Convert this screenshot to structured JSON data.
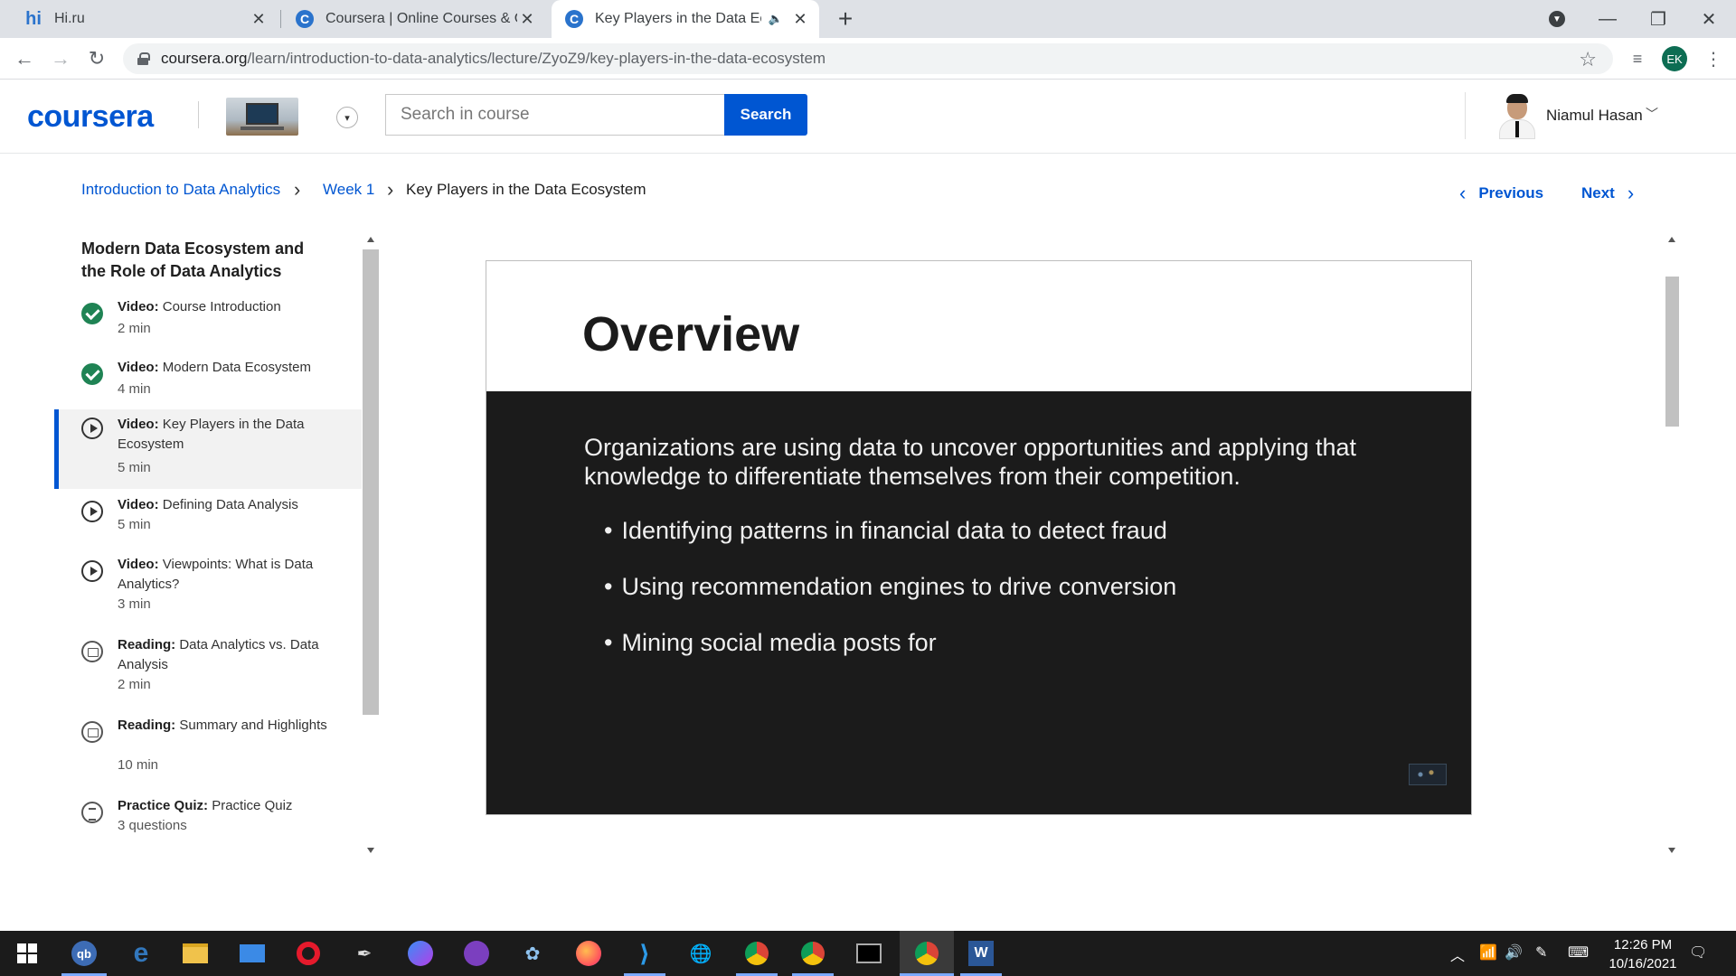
{
  "browser": {
    "tabs": [
      {
        "title": "Hi.ru",
        "favicon": "hi-ru-icon"
      },
      {
        "title": "Coursera | Online Courses & Credentials",
        "favicon": "coursera-icon"
      },
      {
        "title": "Key Players in the Data Ecosystem",
        "favicon": "coursera-icon",
        "active": true
      }
    ],
    "hi_logo": "hi",
    "coursera_favicon_letter": "C",
    "url_domain": "coursera.org",
    "url_path": "/learn/introduction-to-data-analytics/lecture/ZyoZ9/key-players-in-the-data-ecosystem",
    "profile_initials": "EK"
  },
  "header": {
    "logo": "coursera",
    "search_placeholder": "Search in course",
    "search_button": "Search",
    "user_name": "Niamul Hasan",
    "brand_color": "#0056d2"
  },
  "breadcrumb": {
    "course": "Introduction to Data Analytics",
    "week": "Week 1",
    "current": "Key Players in the Data Ecosystem"
  },
  "pager": {
    "previous": "Previous",
    "next": "Next"
  },
  "sidebar": {
    "section_title": "Modern Data Ecosystem and the Role of Data Analytics",
    "items": [
      {
        "type": "Video:",
        "title": "Course Introduction",
        "meta": "2 min",
        "status": "completed"
      },
      {
        "type": "Video:",
        "title": "Modern Data Ecosystem",
        "meta": "4 min",
        "status": "completed"
      },
      {
        "type": "Video:",
        "title": "Key Players in the Data Ecosystem",
        "meta": "5 min",
        "status": "current"
      },
      {
        "type": "Video:",
        "title": "Defining Data Analysis",
        "meta": "5 min",
        "status": "video"
      },
      {
        "type": "Video:",
        "title": "Viewpoints: What is Data Analytics?",
        "meta": "3 min",
        "status": "video"
      },
      {
        "type": "Reading:",
        "title": "Data Analytics vs. Data Analysis",
        "meta": "2 min",
        "status": "reading"
      },
      {
        "type": "Reading:",
        "title": "Summary and Highlights",
        "meta": "10 min",
        "status": "reading"
      },
      {
        "type": "Practice Quiz:",
        "title": "Practice Quiz",
        "meta": "3 questions",
        "status": "quiz"
      }
    ]
  },
  "slide": {
    "title": "Overview",
    "paragraph": "Organizations are using data to uncover opportunities and applying that knowledge to differentiate themselves from their competition.",
    "bullets": [
      "Identifying patterns in financial data to detect fraud",
      "Using recommendation engines to drive conversion",
      "Mining social media posts for"
    ]
  },
  "taskbar": {
    "time": "12:26 PM",
    "date": "10/16/2021",
    "apps": [
      "start-icon",
      "qbittorrent-icon",
      "edge-icon",
      "file-explorer-icon",
      "mail-icon",
      "opera-icon",
      "inkscape-icon",
      "messenger-icon",
      "github-desktop-icon",
      "paint-icon",
      "firefox-icon",
      "vscode-icon",
      "globe-app-icon",
      "chrome-icon",
      "chrome-profile-icon",
      "terminal-icon",
      "chrome-ek-icon",
      "word-icon"
    ]
  }
}
